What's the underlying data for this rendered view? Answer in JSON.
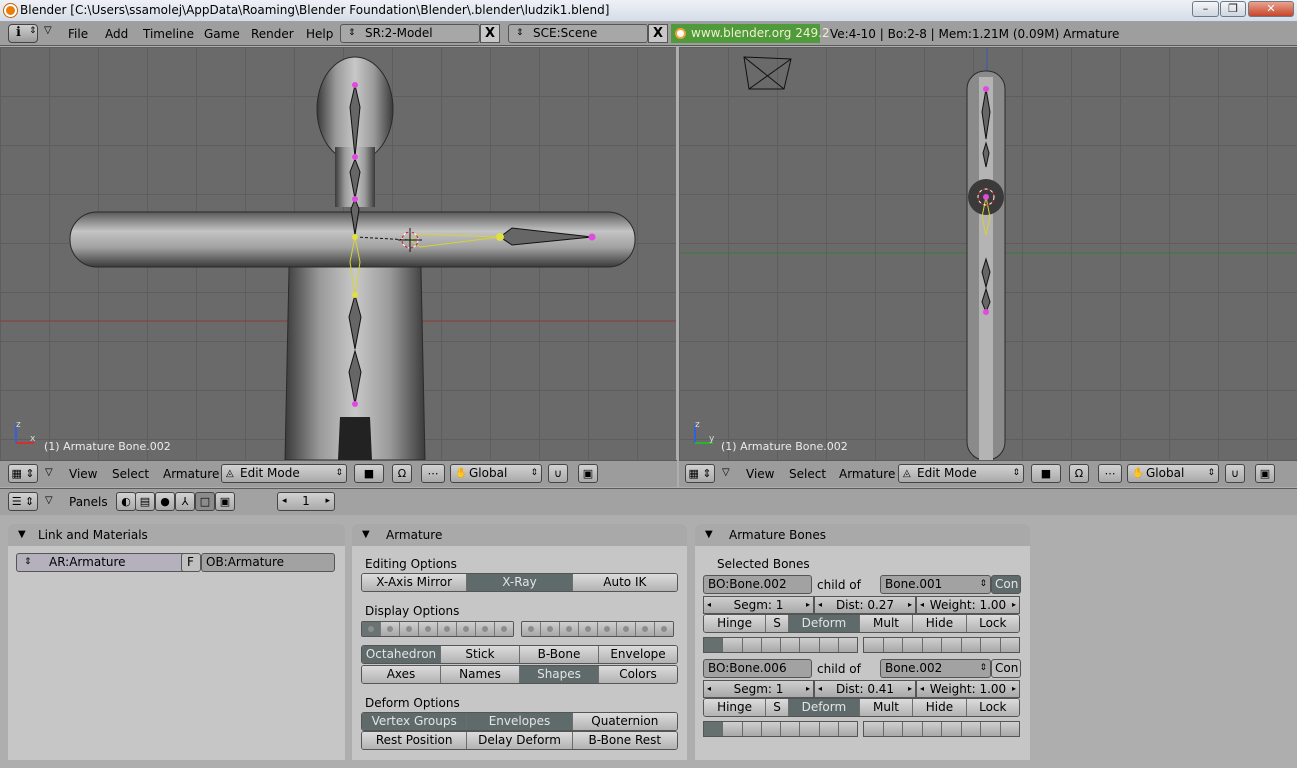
{
  "window": {
    "title": "Blender [C:\\Users\\ssamolej\\AppData\\Roaming\\Blender Foundation\\Blender\\.blender\\ludzik1.blend]",
    "minimize": "–",
    "maximize": "❐",
    "close": "✕"
  },
  "menubar": {
    "menus": [
      "File",
      "Add",
      "Timeline",
      "Game",
      "Render",
      "Help"
    ],
    "screen": "SR:2-Model",
    "scene": "SCE:Scene",
    "close_x": "X",
    "url_badge": "www.blender.org 249.2",
    "stats": "Ve:4-10 | Bo:2-8 | Mem:1.21M (0.09M) Armature",
    "badge_color": "#4f9a3a"
  },
  "viewport_left": {
    "info": "(1) Armature Bone.002",
    "header": {
      "view": "View",
      "select": "Select",
      "armature": "Armature",
      "mode": "Edit Mode",
      "orientation": "Global"
    }
  },
  "viewport_right": {
    "info": "(1) Armature Bone.002",
    "header": {
      "view": "View",
      "select": "Select",
      "armature": "Armature",
      "mode": "Edit Mode",
      "orientation": "Global"
    }
  },
  "buttons_header": {
    "panels": "Panels",
    "page": "1"
  },
  "link_materials": {
    "title": "Link and Materials",
    "armature_field": "AR:Armature",
    "f_button": "F",
    "object_field": "OB:Armature"
  },
  "armature_panel": {
    "title": "Armature",
    "editing_label": "Editing Options",
    "editing_buttons": [
      {
        "label": "X-Axis Mirror",
        "on": false
      },
      {
        "label": "X-Ray",
        "on": true
      },
      {
        "label": "Auto IK",
        "on": false
      }
    ],
    "display_label": "Display Options",
    "layers_a": [
      true,
      false,
      false,
      false,
      false,
      false,
      false,
      false
    ],
    "layers_b": [
      false,
      false,
      false,
      false,
      false,
      false,
      false,
      false
    ],
    "draw_row1": [
      {
        "label": "Octahedron",
        "on": true
      },
      {
        "label": "Stick",
        "on": false
      },
      {
        "label": "B-Bone",
        "on": false
      },
      {
        "label": "Envelope",
        "on": false
      }
    ],
    "draw_row2": [
      {
        "label": "Axes",
        "on": false
      },
      {
        "label": "Names",
        "on": false
      },
      {
        "label": "Shapes",
        "on": true
      },
      {
        "label": "Colors",
        "on": false
      }
    ],
    "deform_label": "Deform Options",
    "deform_row1": [
      {
        "label": "Vertex Groups",
        "on": true
      },
      {
        "label": "Envelopes",
        "on": true
      },
      {
        "label": "Quaternion",
        "on": false
      }
    ],
    "deform_row2": [
      {
        "label": "Rest Position",
        "on": false
      },
      {
        "label": "Delay Deform",
        "on": false
      },
      {
        "label": "B-Bone Rest",
        "on": false
      }
    ]
  },
  "bones_panel": {
    "title": "Armature Bones",
    "selected_label": "Selected Bones",
    "bones": [
      {
        "name": "BO:Bone.002",
        "child_of": "child of",
        "parent": "Bone.001",
        "con": "Con",
        "segm": "Segm: 1",
        "dist": "Dist: 0.27",
        "weight": "Weight: 1.00",
        "flags": [
          {
            "label": "Hinge",
            "on": false
          },
          {
            "label": "S",
            "on": false
          },
          {
            "label": "Deform",
            "on": true
          },
          {
            "label": "Mult",
            "on": false
          },
          {
            "label": "Hide",
            "on": false
          },
          {
            "label": "Lock",
            "on": false
          }
        ]
      },
      {
        "name": "BO:Bone.006",
        "child_of": "child of",
        "parent": "Bone.002",
        "con": "Con",
        "segm": "Segm: 1",
        "dist": "Dist: 0.41",
        "weight": "Weight: 1.00",
        "flags": [
          {
            "label": "Hinge",
            "on": false
          },
          {
            "label": "S",
            "on": false
          },
          {
            "label": "Deform",
            "on": true
          },
          {
            "label": "Mult",
            "on": false
          },
          {
            "label": "Hide",
            "on": false
          },
          {
            "label": "Lock",
            "on": false
          }
        ]
      }
    ]
  }
}
